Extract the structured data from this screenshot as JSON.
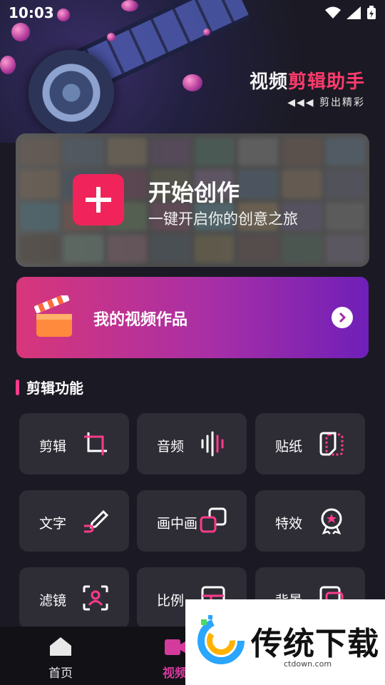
{
  "status": {
    "time": "10:03"
  },
  "hero": {
    "brand_white": "视频",
    "brand_red": "剪辑助手",
    "tagline": "◀◀◀ 剪出精彩"
  },
  "create_card": {
    "title": "开始创作",
    "subtitle": "一键开启你的创意之旅"
  },
  "works_card": {
    "label": "我的视频作品"
  },
  "section": {
    "title": "剪辑功能"
  },
  "tools": [
    {
      "label": "剪辑",
      "icon": "crop-icon"
    },
    {
      "label": "音频",
      "icon": "audio-wave-icon"
    },
    {
      "label": "贴纸",
      "icon": "sticker-icon"
    },
    {
      "label": "文字",
      "icon": "pen-text-icon"
    },
    {
      "label": "画中画",
      "icon": "picture-in-picture-icon"
    },
    {
      "label": "特效",
      "icon": "effect-badge-icon"
    },
    {
      "label": "滤镜",
      "icon": "filter-person-icon"
    },
    {
      "label": "比例",
      "icon": "ratio-icon"
    },
    {
      "label": "背景",
      "icon": "background-icon"
    }
  ],
  "tabs": [
    {
      "label": "首页",
      "icon": "home-icon"
    },
    {
      "label": "视频",
      "icon": "video-icon"
    }
  ],
  "ad": {
    "brand": "传统下载",
    "site": "ctdown.com"
  },
  "colors": {
    "accent": "#f0245a",
    "tab_active": "#d53a9d",
    "card": "#2e2d36"
  }
}
